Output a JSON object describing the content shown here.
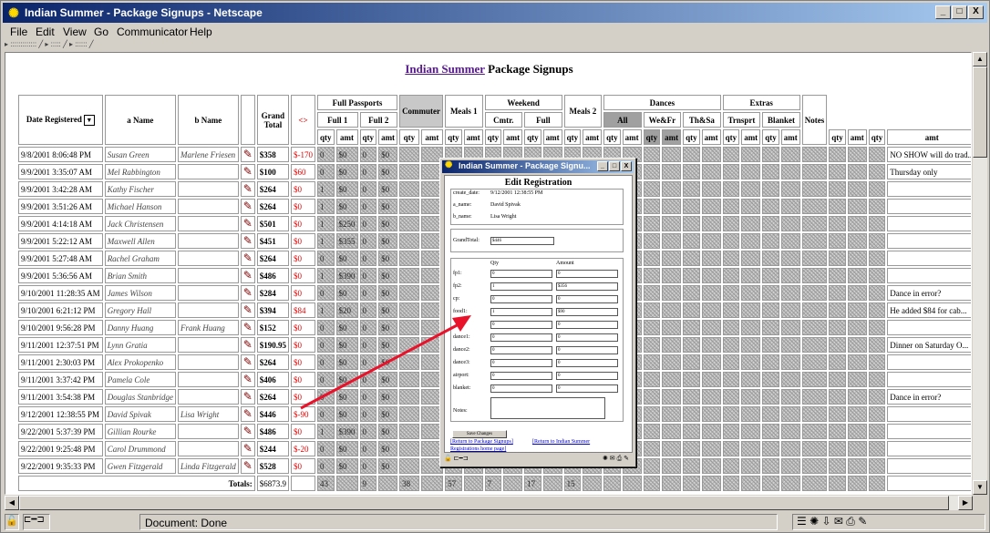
{
  "window": {
    "title": "Indian Summer - Package Signups - Netscape",
    "controls": {
      "minimize": "_",
      "maximize": "□",
      "close": "X"
    }
  },
  "menu": [
    {
      "label": "File"
    },
    {
      "label": "Edit"
    },
    {
      "label": "View"
    },
    {
      "label": "Go"
    },
    {
      "label": "Communicator"
    },
    {
      "label": "Help"
    }
  ],
  "page": {
    "title_link": "Indian Summer",
    "title_rest": " Package Signups"
  },
  "table": {
    "headers": {
      "date": "Date Registered",
      "a_name": "a Name",
      "b_name": "b Name",
      "grand_total": "Grand Total",
      "diff": "<>",
      "full_passports": "Full Passports",
      "full1": "Full 1",
      "full2": "Full 2",
      "commuter": "Commuter",
      "meals1": "Meals 1",
      "weekend": "Weekend",
      "cmtr": "Cmtr.",
      "full": "Full",
      "meals2": "Meals 2",
      "dances": "Dances",
      "all": "All",
      "wefr": "We&Fr",
      "thsa": "Th&Sa",
      "extras": "Extras",
      "trnsprt": "Trnsprt",
      "blanket": "Blanket",
      "notes": "Notes",
      "qty": "qty",
      "amt": "amt"
    },
    "rows": [
      {
        "date": "9/8/2001 8:06:48 PM",
        "a": "Susan Green",
        "b": "Marlene Friesen",
        "total": "$358",
        "diff": "$-170",
        "q1": "0",
        "a1": "$0",
        "q2": "0",
        "a2": "$0",
        "note": "NO SHOW will do trad..."
      },
      {
        "date": "9/9/2001 3:35:07 AM",
        "a": "Mel Rabbington",
        "b": "",
        "total": "$100",
        "diff": "$60",
        "q1": "0",
        "a1": "$0",
        "q2": "0",
        "a2": "$0",
        "note": "Thursday only"
      },
      {
        "date": "9/9/2001 3:42:28 AM",
        "a": "Kathy Fischer",
        "b": "",
        "total": "$264",
        "diff": "$0",
        "q1": "1",
        "a1": "$0",
        "q2": "0",
        "a2": "$0",
        "note": ""
      },
      {
        "date": "9/9/2001 3:51:26 AM",
        "a": "Michael Hanson",
        "b": "",
        "total": "$264",
        "diff": "$0",
        "q1": "1",
        "a1": "$0",
        "q2": "0",
        "a2": "$0",
        "note": ""
      },
      {
        "date": "9/9/2001 4:14:18 AM",
        "a": "Jack Christensen",
        "b": "",
        "total": "$501",
        "diff": "$0",
        "q1": "1",
        "a1": "$250",
        "q2": "0",
        "a2": "$0",
        "note": ""
      },
      {
        "date": "9/9/2001 5:22:12 AM",
        "a": "Maxwell Allen",
        "b": "",
        "total": "$451",
        "diff": "$0",
        "q1": "1",
        "a1": "$355",
        "q2": "0",
        "a2": "$0",
        "note": ""
      },
      {
        "date": "9/9/2001 5:27:48 AM",
        "a": "Rachel Graham",
        "b": "",
        "total": "$264",
        "diff": "$0",
        "q1": "0",
        "a1": "$0",
        "q2": "0",
        "a2": "$0",
        "note": ""
      },
      {
        "date": "9/9/2001 5:36:56 AM",
        "a": "Brian Smith",
        "b": "",
        "total": "$486",
        "diff": "$0",
        "q1": "1",
        "a1": "$390",
        "q2": "0",
        "a2": "$0",
        "note": ""
      },
      {
        "date": "9/10/2001 11:28:35 AM",
        "a": "James Wilson",
        "b": "",
        "total": "$284",
        "diff": "$0",
        "q1": "0",
        "a1": "$0",
        "q2": "0",
        "a2": "$0",
        "note": "Dance in error?"
      },
      {
        "date": "9/10/2001 6:21:12 PM",
        "a": "Gregory Hall",
        "b": "",
        "total": "$394",
        "diff": "$84",
        "q1": "1",
        "a1": "$20",
        "q2": "0",
        "a2": "$0",
        "note": "He added $84 for cab..."
      },
      {
        "date": "9/10/2001 9:56:28 PM",
        "a": "Danny Huang",
        "b": "Frank Huang",
        "total": "$152",
        "diff": "$0",
        "q1": "0",
        "a1": "$0",
        "q2": "0",
        "a2": "$0",
        "note": ""
      },
      {
        "date": "9/11/2001 12:37:51 PM",
        "a": "Lynn Gratia",
        "b": "",
        "total": "$190.95",
        "diff": "$0",
        "q1": "0",
        "a1": "$0",
        "q2": "0",
        "a2": "$0",
        "note": "Dinner on Saturday O..."
      },
      {
        "date": "9/11/2001 2:30:03 PM",
        "a": "Alex Prokopenko",
        "b": "",
        "total": "$264",
        "diff": "$0",
        "q1": "0",
        "a1": "$0",
        "q2": "0",
        "a2": "$0",
        "note": ""
      },
      {
        "date": "9/11/2001 3:37:42 PM",
        "a": "Pamela Cole",
        "b": "",
        "total": "$406",
        "diff": "$0",
        "q1": "0",
        "a1": "$0",
        "q2": "0",
        "a2": "$0",
        "note": ""
      },
      {
        "date": "9/11/2001 3:54:38 PM",
        "a": "Douglas Stanbridge",
        "b": "",
        "total": "$264",
        "diff": "$0",
        "q1": "0",
        "a1": "$0",
        "q2": "0",
        "a2": "$0",
        "note": "Dance in error?"
      },
      {
        "date": "9/12/2001 12:38:55 PM",
        "a": "David Spivak",
        "b": "Lisa Wright",
        "total": "$446",
        "diff": "$-90",
        "q1": "0",
        "a1": "$0",
        "q2": "0",
        "a2": "$0",
        "note": ""
      },
      {
        "date": "9/22/2001 5:37:39 PM",
        "a": "Gillian Rourke",
        "b": "",
        "total": "$486",
        "diff": "$0",
        "q1": "1",
        "a1": "$390",
        "q2": "0",
        "a2": "$0",
        "note": ""
      },
      {
        "date": "9/22/2001 9:25:48 PM",
        "a": "Carol Drummond",
        "b": "",
        "total": "$244",
        "diff": "$-20",
        "q1": "0",
        "a1": "$0",
        "q2": "0",
        "a2": "$0",
        "note": ""
      },
      {
        "date": "9/22/2001 9:35:33 PM",
        "a": "Gwen Fitzgerald",
        "b": "Linda Fitzgerald",
        "total": "$528",
        "diff": "$0",
        "q1": "0",
        "a1": "$0",
        "q2": "0",
        "a2": "$0",
        "note": ""
      }
    ],
    "totals": {
      "label": "Totals:",
      "grand": "$6873.9",
      "c1": "43",
      "c2": "9",
      "c3": "38",
      "c4": "57",
      "c5": "7",
      "c6": "17",
      "c7": "15"
    }
  },
  "popup": {
    "title": "Indian Summer - Package Signu...",
    "heading": "Edit Registration",
    "create_label": "create_date:",
    "create_value": "9/12/2001 12:38:55 PM",
    "a_name_label": "a_name:",
    "a_name_value": "David Spivak",
    "b_name_label": "b_name:",
    "b_name_value": "Lisa Wright",
    "grand_label": "GrandTotal:",
    "grand_value": "$446",
    "qty_header": "Qty",
    "amount_header": "Amount",
    "fields": [
      {
        "label": "fp1:",
        "qty": "0",
        "amt": "0"
      },
      {
        "label": "fp2:",
        "qty": "1",
        "amt": "$356"
      },
      {
        "label": "cp:",
        "qty": "0",
        "amt": "0"
      },
      {
        "label": "food1:",
        "qty": "1",
        "amt": "$90"
      },
      {
        "label": "",
        "qty": "0",
        "amt": "0"
      },
      {
        "label": "dance1:",
        "qty": "0",
        "amt": "0"
      },
      {
        "label": "dance2:",
        "qty": "0",
        "amt": "0"
      },
      {
        "label": "dance3:",
        "qty": "0",
        "amt": "0"
      },
      {
        "label": "airport:",
        "qty": "0",
        "amt": "0"
      },
      {
        "label": "blanket:",
        "qty": "0",
        "amt": "0"
      }
    ],
    "notes_label": "Notes:",
    "save_label": "Save Changes",
    "link1": "[Return to Package Signups]",
    "link2": "[Return to Indian Summer",
    "link3": "Registrations home page]"
  },
  "status": {
    "text": "Document: Done"
  },
  "colors": {
    "accent": "#0a246a",
    "negative": "#e00000",
    "link": "#551a8b",
    "annotation": "#e8132a"
  }
}
